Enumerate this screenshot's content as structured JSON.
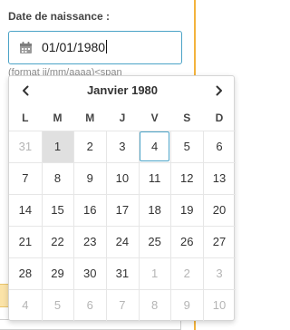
{
  "form": {
    "label": "Date de naissance :",
    "input_value": "01/01/1980",
    "format_hint": "(format jj/mm/aaaa)<span",
    "icon": "calendar-icon"
  },
  "calendar": {
    "month_title": "Janvier 1980",
    "prev_icon": "chevron-left-icon",
    "next_icon": "chevron-right-icon",
    "weekdays": [
      "L",
      "M",
      "M",
      "J",
      "V",
      "S",
      "D"
    ],
    "weeks": [
      [
        {
          "d": "31",
          "muted": true
        },
        {
          "d": "1",
          "selected": true
        },
        {
          "d": "2"
        },
        {
          "d": "3"
        },
        {
          "d": "4",
          "focused": true
        },
        {
          "d": "5"
        },
        {
          "d": "6"
        }
      ],
      [
        {
          "d": "7"
        },
        {
          "d": "8"
        },
        {
          "d": "9"
        },
        {
          "d": "10"
        },
        {
          "d": "11"
        },
        {
          "d": "12"
        },
        {
          "d": "13"
        }
      ],
      [
        {
          "d": "14"
        },
        {
          "d": "15"
        },
        {
          "d": "16"
        },
        {
          "d": "17"
        },
        {
          "d": "18"
        },
        {
          "d": "19"
        },
        {
          "d": "20"
        }
      ],
      [
        {
          "d": "21"
        },
        {
          "d": "22"
        },
        {
          "d": "23"
        },
        {
          "d": "24"
        },
        {
          "d": "25"
        },
        {
          "d": "26"
        },
        {
          "d": "27"
        }
      ],
      [
        {
          "d": "28"
        },
        {
          "d": "29"
        },
        {
          "d": "30"
        },
        {
          "d": "31"
        },
        {
          "d": "1",
          "muted": true
        },
        {
          "d": "2",
          "muted": true
        },
        {
          "d": "3",
          "muted": true
        }
      ],
      [
        {
          "d": "4",
          "muted": true
        },
        {
          "d": "5",
          "muted": true
        },
        {
          "d": "6",
          "muted": true
        },
        {
          "d": "7",
          "muted": true
        },
        {
          "d": "8",
          "muted": true
        },
        {
          "d": "9",
          "muted": true
        },
        {
          "d": "10",
          "muted": true
        }
      ]
    ]
  },
  "colors": {
    "accent": "#4ba3c7",
    "panel_edge": "#f3b33d",
    "selected_bg": "#e0e0e0",
    "muted_text": "#b5b5b5"
  }
}
